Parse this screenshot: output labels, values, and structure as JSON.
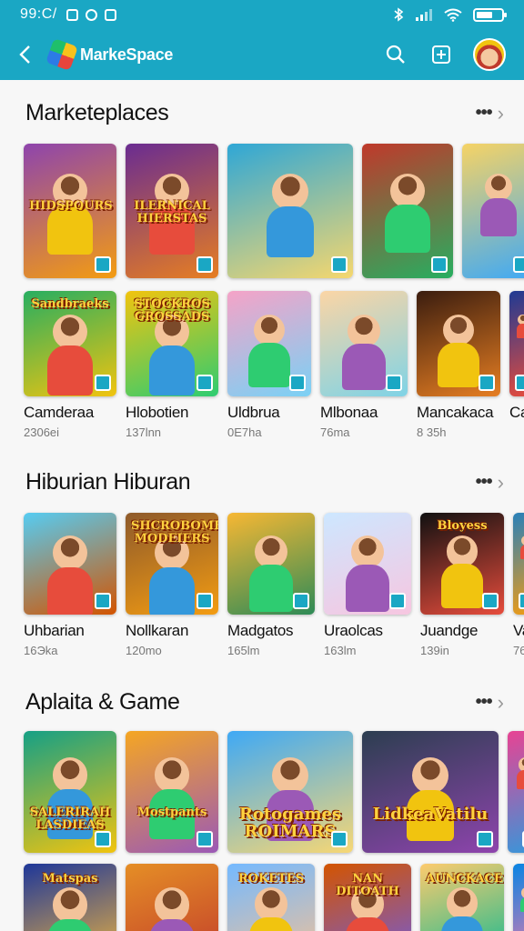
{
  "status": {
    "time": "99:C/"
  },
  "appbar": {
    "brand": "MarkeSpace"
  },
  "sections": [
    {
      "title": "Marketeplaces",
      "rows": [
        {
          "items": [
            {
              "art": "HIDSPOURS",
              "bg": [
                "#8e44ad",
                "#f39c12"
              ]
            },
            {
              "art": "ILERNICAL HIERSTAS",
              "bg": [
                "#6a2c91",
                "#e67e22"
              ]
            },
            {
              "art": "",
              "bg": [
                "#2fa7d6",
                "#f5d76e"
              ]
            },
            {
              "art": "",
              "bg": [
                "#c0392b",
                "#27ae60"
              ]
            },
            {
              "art": "",
              "bg": [
                "#f6d365",
                "#3fa9f5"
              ]
            }
          ]
        },
        {
          "items": [
            {
              "art": "Sandbraeks",
              "bg": [
                "#27ae60",
                "#f1c40f"
              ],
              "label": "Camderaa",
              "sub": "2306ei"
            },
            {
              "art": "STOCKROS GROSSADS",
              "bg": [
                "#f1c40f",
                "#2ecc71"
              ],
              "label": "Hlobotien",
              "sub": "137lnn"
            },
            {
              "art": "",
              "bg": [
                "#f5a3c7",
                "#7ad1f5"
              ],
              "label": "Uldbrua",
              "sub": "0E7ha"
            },
            {
              "art": "",
              "bg": [
                "#fbd5a5",
                "#7fd3e6"
              ],
              "label": "Mlbonaa",
              "sub": "76ma"
            },
            {
              "art": "",
              "bg": [
                "#3b1d0f",
                "#e67e22"
              ],
              "label": "Mancakaca",
              "sub": "8 35h"
            },
            {
              "art": "",
              "bg": [
                "#1f3a93",
                "#e74c3c"
              ],
              "label": "Ca",
              "sub": ""
            }
          ]
        }
      ]
    },
    {
      "title": "Hiburian Hiburan",
      "rows": [
        {
          "items": [
            {
              "art": "",
              "bg": [
                "#56ccf2",
                "#d35400"
              ],
              "label": "Uhbarian",
              "sub": "16Эka"
            },
            {
              "art": "SHCROBOMEIS MODEIERS",
              "bg": [
                "#8e5a2b",
                "#f39c12"
              ],
              "label": "Nollkaran",
              "sub": "120mo"
            },
            {
              "art": "",
              "bg": [
                "#f7b733",
                "#2e8b57"
              ],
              "label": "Madgatos",
              "sub": "165lm"
            },
            {
              "art": "",
              "bg": [
                "#cde7ff",
                "#f7c6e0"
              ],
              "label": "Uraolcas",
              "sub": "163lm"
            },
            {
              "art": "Bloyess",
              "bg": [
                "#111111",
                "#e74c3c"
              ],
              "label": "Juandge",
              "sub": "139in"
            },
            {
              "art": "",
              "bg": [
                "#2980b9",
                "#f39c12"
              ],
              "label": "Va",
              "sub": "76"
            }
          ]
        }
      ]
    },
    {
      "title": "Aplaita & Game",
      "rows": [
        {
          "items": [
            {
              "art": "SALERIRAH LASDIEAS",
              "bg": [
                "#16a085",
                "#f1c40f"
              ]
            },
            {
              "art": "Mostpants",
              "bg": [
                "#f5a623",
                "#9b59b6"
              ]
            },
            {
              "art": "Rotogames ROIMARS",
              "bg": [
                "#3fa9f5",
                "#f7d774"
              ]
            },
            {
              "art": "LidkeaVatilu",
              "bg": [
                "#2c3e50",
                "#8e44ad"
              ]
            },
            {
              "art": "",
              "bg": [
                "#e84393",
                "#3498db"
              ]
            }
          ]
        },
        {
          "items": [
            {
              "art": "Matspas",
              "bg": [
                "#1e3799",
                "#f6b93b"
              ]
            },
            {
              "art": "",
              "bg": [
                "#e58e26",
                "#c0392b"
              ]
            },
            {
              "art": "ROKETES",
              "bg": [
                "#74b9ff",
                "#f8c291"
              ]
            },
            {
              "art": "NAN DITOATH",
              "bg": [
                "#d35400",
                "#6c5ce7"
              ]
            },
            {
              "art": "AUNCKACE",
              "bg": [
                "#fdcb6e",
                "#00b894"
              ]
            },
            {
              "art": "",
              "bg": [
                "#0984e3",
                "#fd79a8"
              ]
            }
          ]
        }
      ]
    }
  ]
}
